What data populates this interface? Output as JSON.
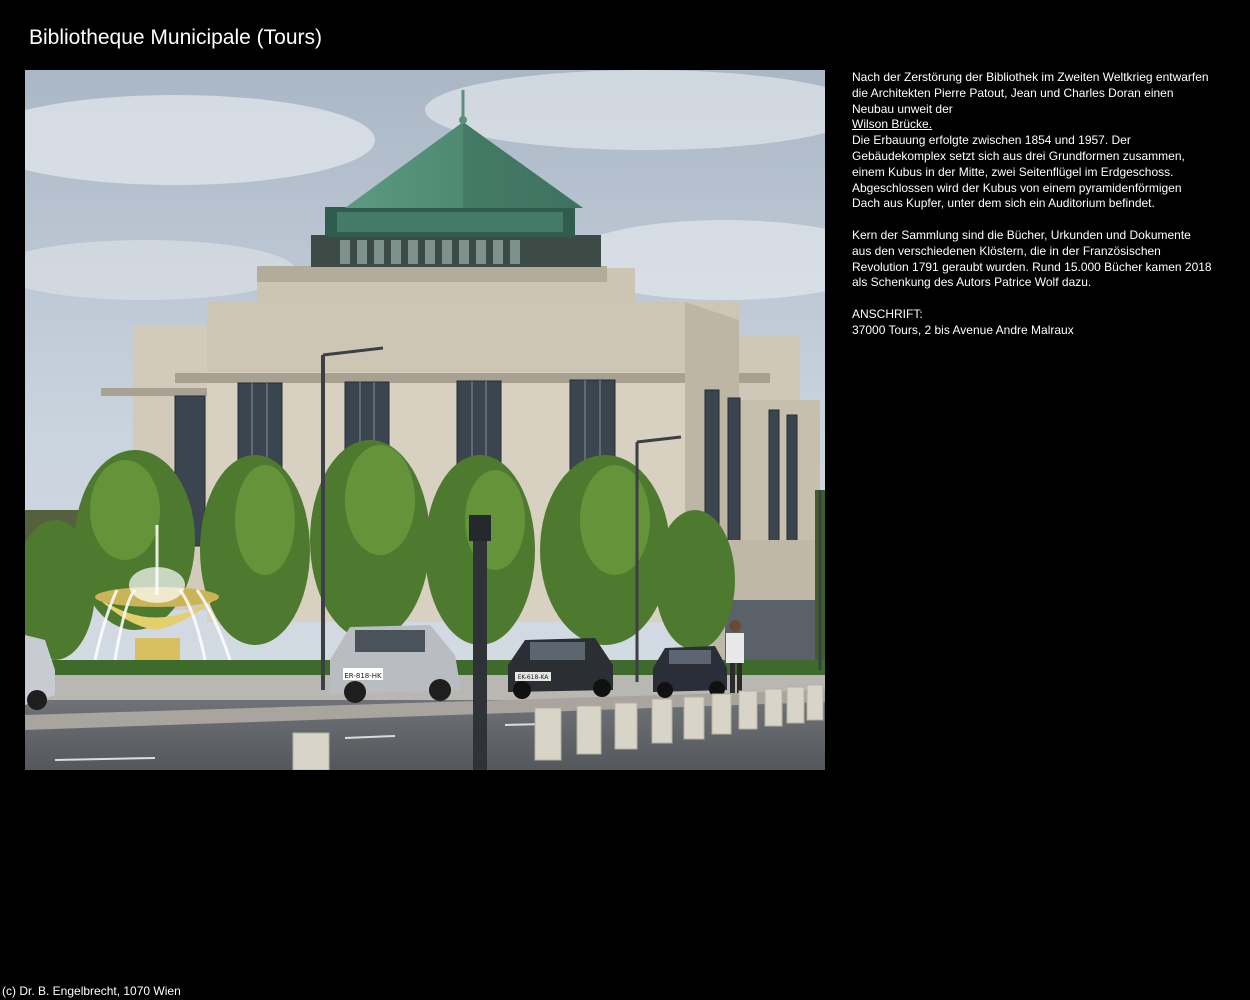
{
  "page": {
    "title": "Bibliotheque Municipale (Tours)",
    "footer": "(c) Dr. B. Engelbrecht, 1070 Wien"
  },
  "photo": {
    "subject": "Bibliotheque Municipale Tours building with fountain, trees, cars and bollards",
    "plates": [
      "ER-818-HK",
      "EK-618-KA"
    ]
  },
  "description": {
    "para1_text": "Nach der Zerstörung der Bibliothek im Zweiten Weltkrieg entwarfen die Architekten Pierre Patout, Jean und Charles Doran einen Neubau unweit der",
    "para1_link": "Wilson Brücke.",
    "para1_rest": "Die Erbauung erfolgte zwischen 1854 und 1957. Der Gebäudekomplex setzt sich aus drei Grundformen zusammen, einem Kubus in der Mitte, zwei Seitenflügel im Erdgeschoss. Abgeschlossen wird der Kubus von einem pyramidenförmigen Dach aus Kupfer, unter dem sich ein Auditorium befindet.",
    "para2": "Kern der Sammlung sind die Bücher, Urkunden und Dokumente aus den verschiedenen Klöstern, die in der Französischen Revolution 1791 geraubt wurden. Rund 15.000 Bücher kamen 2018 als Schenkung des Autors Patrice Wolf dazu.",
    "address_label": "ANSCHRIFT:",
    "address": "37000 Tours, 2 bis Avenue Andre Malraux"
  },
  "colors": {
    "background": "#000000",
    "text": "#ffffff",
    "copper_roof": "#4f8c74"
  }
}
